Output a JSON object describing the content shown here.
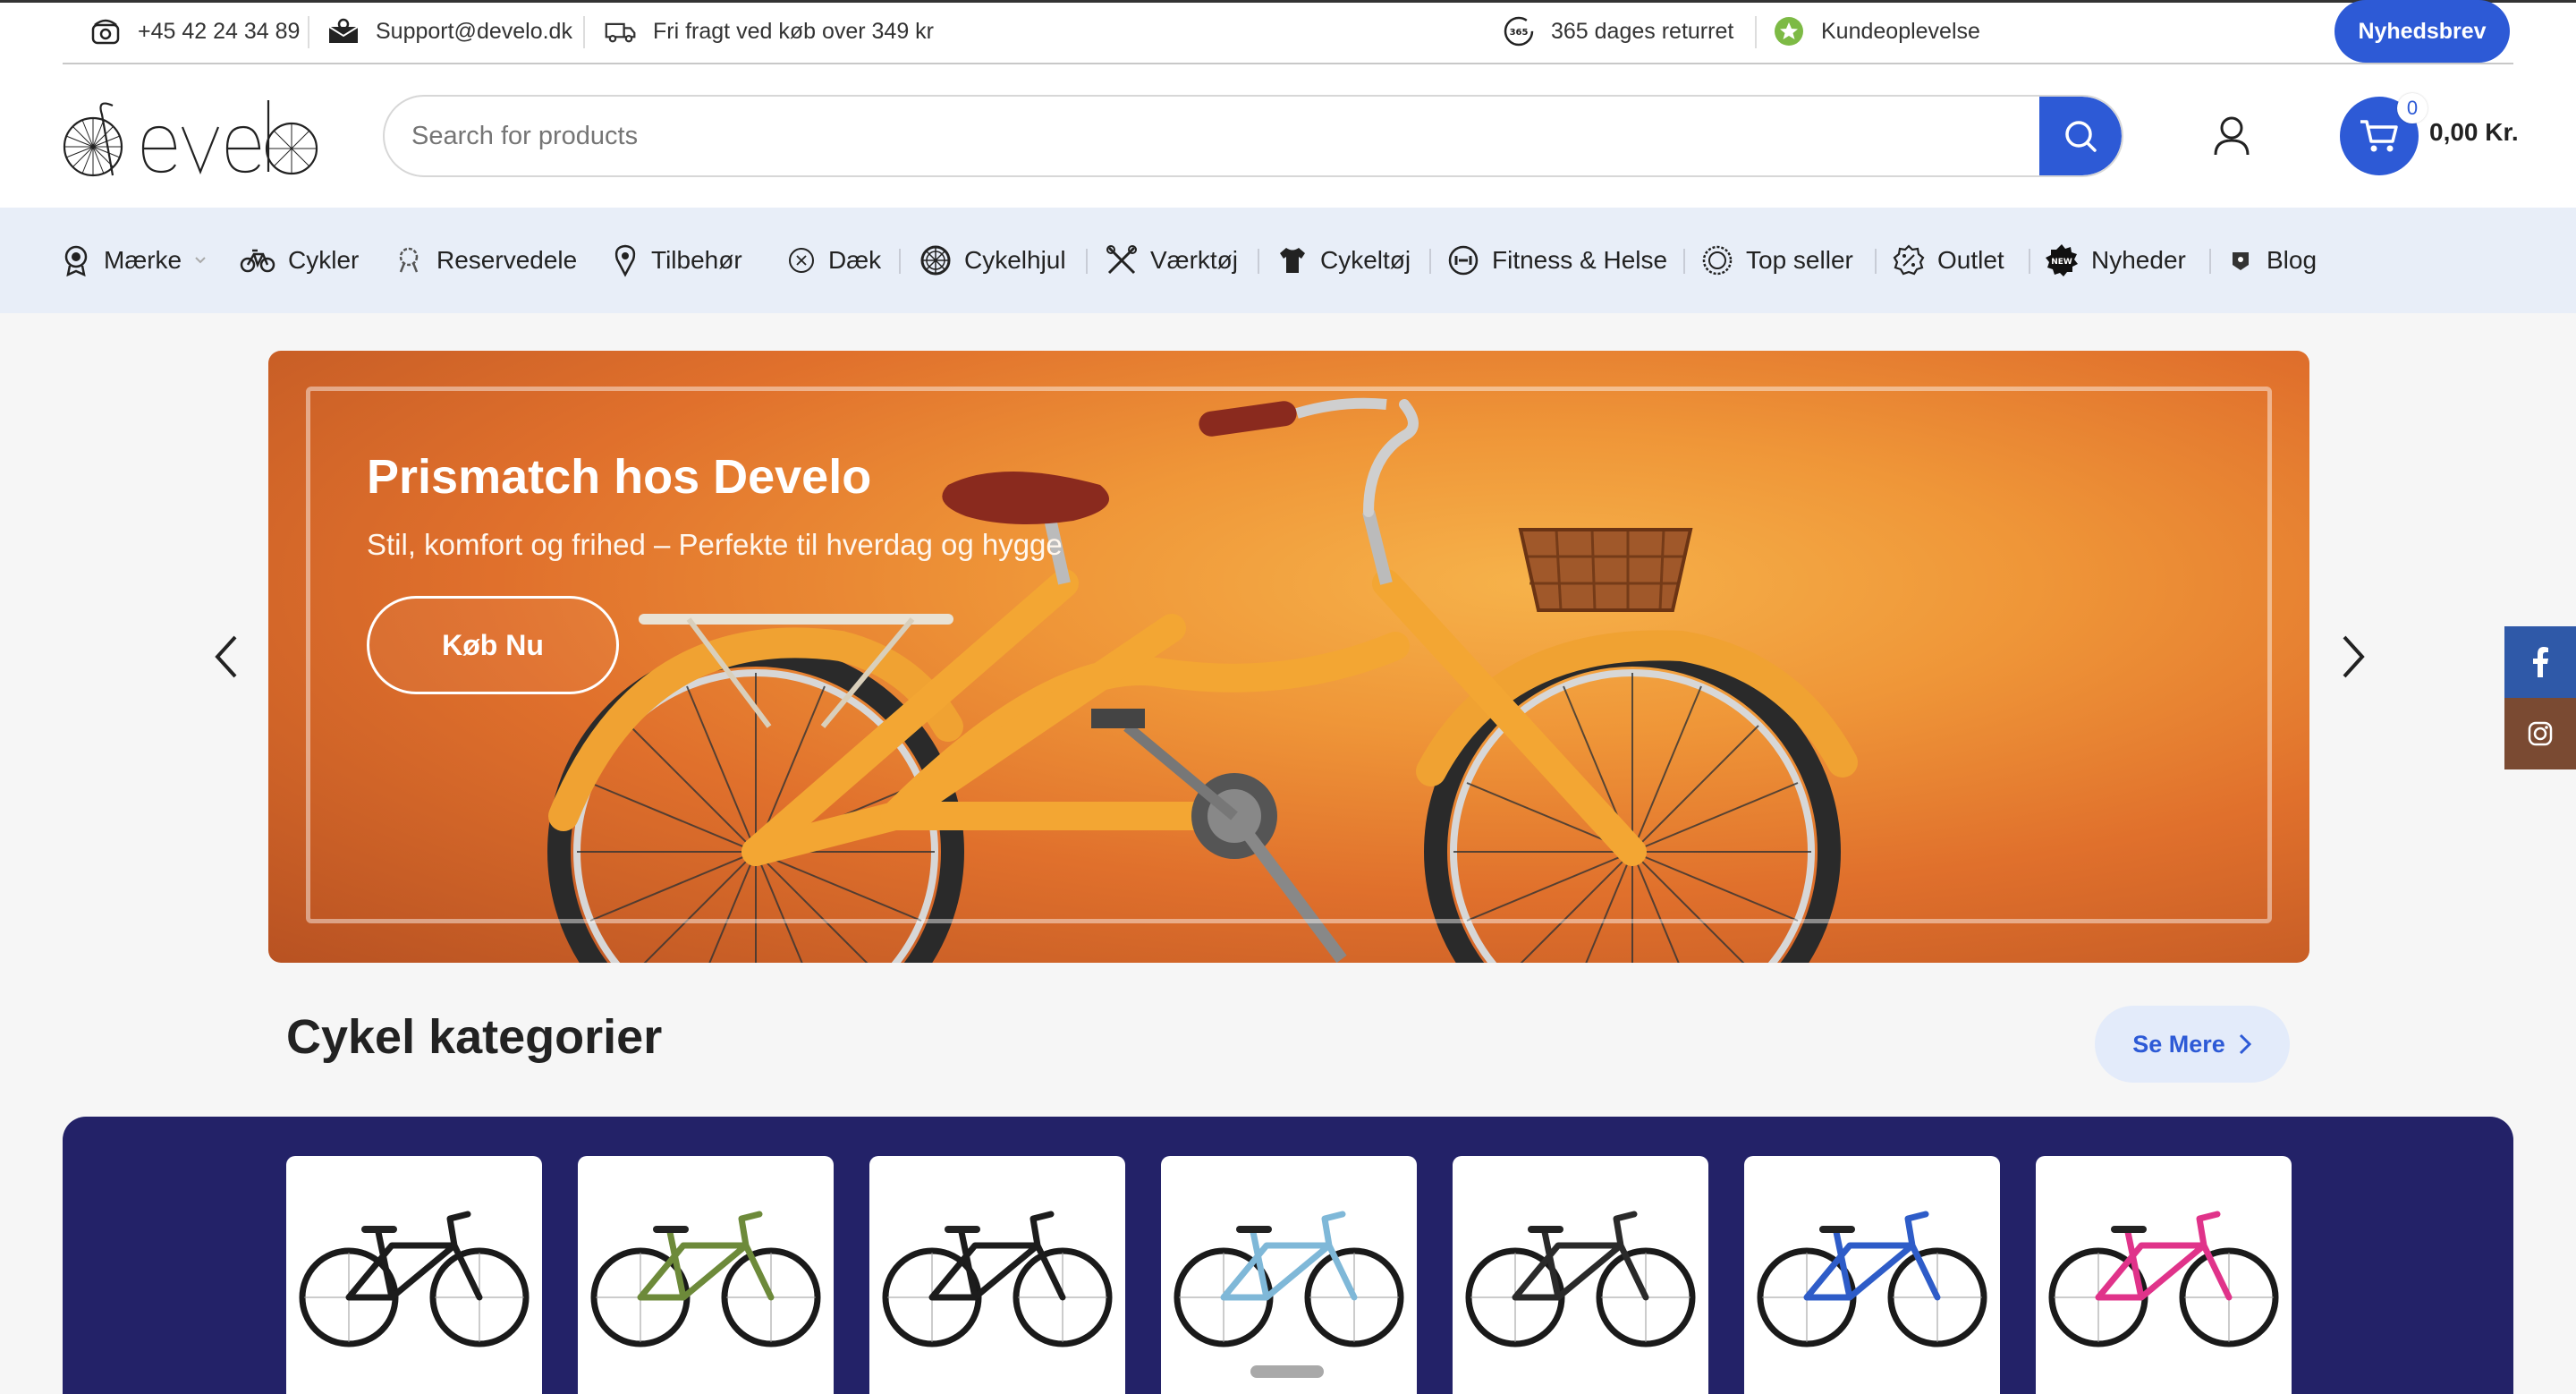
{
  "topbar": {
    "phone": "+45 42 24 34 89",
    "email": "Support@develo.dk",
    "shipping": "Fri fragt ved køb over 349 kr",
    "returns": "365 dages returret",
    "experience": "Kundeoplevelse",
    "newsletter": "Nyhedsbrev"
  },
  "header": {
    "logo_text": "develo",
    "search_placeholder": "Search for products",
    "cart_count": "0",
    "cart_total": "0,00 Kr."
  },
  "nav": {
    "items": [
      {
        "label": "Mærke",
        "icon": "medal-icon"
      },
      {
        "label": "Cykler",
        "icon": "bicycle-icon"
      },
      {
        "label": "Reservedele",
        "icon": "parts-icon"
      },
      {
        "label": "Tilbehør",
        "icon": "pin-icon"
      },
      {
        "label": "Dæk",
        "icon": "tire-icon"
      },
      {
        "label": "Cykelhjul",
        "icon": "wheel-icon"
      },
      {
        "label": "Værktøj",
        "icon": "tools-icon"
      },
      {
        "label": "Cykeltøj",
        "icon": "jersey-icon"
      },
      {
        "label": "Fitness & Helse",
        "icon": "dumbbell-icon"
      },
      {
        "label": "Top seller",
        "icon": "badge-icon"
      },
      {
        "label": "Outlet",
        "icon": "discount-icon"
      },
      {
        "label": "Nyheder",
        "icon": "new-badge-icon"
      },
      {
        "label": "Blog",
        "icon": "blog-icon"
      }
    ]
  },
  "hero": {
    "title": "Prismatch hos Develo",
    "subtitle": "Stil, komfort og frihed – Perfekte til hverdag og hygge",
    "cta": "Køb Nu"
  },
  "categories": {
    "title": "Cykel kategorier",
    "see_more": "Se Mere",
    "bike_colors": [
      "#1c1c1c",
      "#6d8a3a",
      "#1c1c1c",
      "#7fb8d8",
      "#2a2a2a",
      "#2e5cc8",
      "#e0338a"
    ]
  },
  "colors": {
    "accent": "#2d5ad6",
    "panel": "#232268",
    "facebook": "#2f59a8",
    "instagram": "#7a4a32"
  }
}
